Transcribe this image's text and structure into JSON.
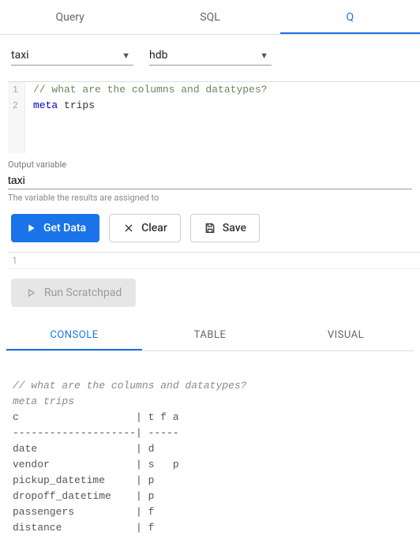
{
  "top_tabs": {
    "query": "Query",
    "sql": "SQL",
    "q": "Q",
    "active": "q"
  },
  "selects": {
    "left": "taxi",
    "right": "hdb"
  },
  "editor": {
    "lines": [
      {
        "n": "1",
        "comment": "// what are the columns and datatypes?"
      },
      {
        "n": "2",
        "keyword": "meta",
        "ident": "trips"
      }
    ]
  },
  "output_var": {
    "label": "Output variable",
    "value": "taxi",
    "help": "The variable the results are assigned to"
  },
  "buttons": {
    "get_data": "Get Data",
    "clear": "Clear",
    "save": "Save"
  },
  "scratch_line": "1",
  "run_scratch": "Run Scratchpad",
  "bottom_tabs": {
    "console": "CONSOLE",
    "table": "TABLE",
    "visual": "VISUAL",
    "active": "console"
  },
  "console": {
    "comment1": "// what are the columns and datatypes?",
    "comment2": "meta trips",
    "rows": [
      "c                   | t f a",
      "--------------------| -----",
      "date                | d    ",
      "vendor              | s   p",
      "pickup_datetime     | p    ",
      "dropoff_datetime    | p    ",
      "passengers          | f    ",
      "distance            | f    "
    ]
  }
}
